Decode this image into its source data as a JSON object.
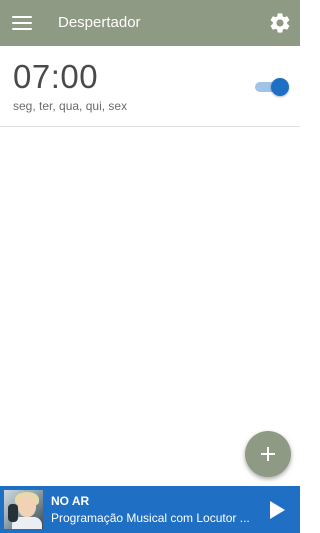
{
  "app_bar": {
    "title": "Despertador",
    "menu_icon": "menu-icon",
    "settings_icon": "gear-icon",
    "background_color": "#8e9a84"
  },
  "alarms": [
    {
      "time": "07:00",
      "days": "seg, ter, qua, qui, sex",
      "enabled": true
    }
  ],
  "fab": {
    "icon": "plus-icon",
    "color": "#8e9a84"
  },
  "player": {
    "label": "NO AR",
    "subtitle": "Programação Musical com Locutor ...",
    "play_icon": "play-icon",
    "background_color": "#1f6fc4"
  }
}
